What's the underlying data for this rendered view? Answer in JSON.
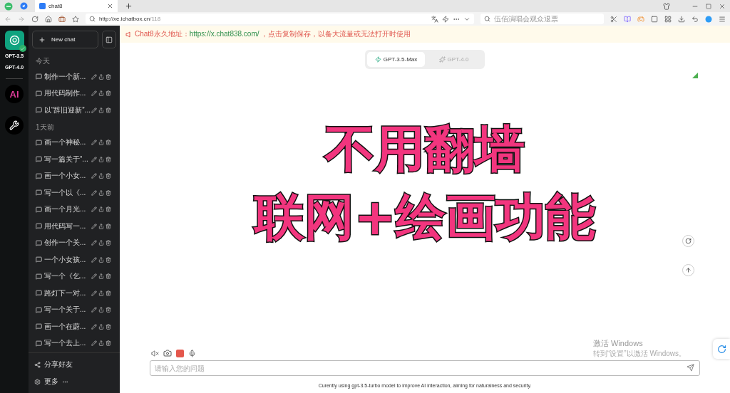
{
  "browser": {
    "tabs": [
      {
        "title": "chat8",
        "selected": true
      }
    ],
    "url": {
      "host": "http://xe.ichatbox.cn",
      "path": "/118"
    },
    "search_placeholder": "伍佰演唱会观众退票"
  },
  "rail": {
    "models": [
      "GPT-3.5",
      "GPT-4.0"
    ],
    "ai_logo": "AI"
  },
  "sidebar": {
    "new_chat": "New chat",
    "groups": [
      {
        "label": "今天",
        "items": [
          "制作一个新...",
          "用代码制作...",
          "以“辞旧迎新”..."
        ]
      },
      {
        "label": "1天前",
        "items": [
          "画一个神秘...",
          "写一篇关于“...",
          "画一个小女...",
          "写一个以《...",
          "画一个月光...",
          "用代码写一...",
          "创作一个关...",
          "一个小女孩...",
          "写一个《乞...",
          "路灯下一对...",
          "写一个关于...",
          "画一个在蔚...",
          "写一个去上..."
        ]
      }
    ],
    "footer": [
      {
        "kind": "share",
        "label": "分享好友"
      },
      {
        "kind": "more",
        "label": "更多"
      }
    ]
  },
  "banner": {
    "prefix": "Chat8永久地址：",
    "link": "https://x.chat838.com/",
    "suffix": " ，点击复制保存，以备大流量或无法打开时使用"
  },
  "model_tabs": [
    {
      "kind": "fast",
      "label": "GPT-3.5-Max",
      "selected": true
    },
    {
      "kind": "spark",
      "label": "GPT-4.0",
      "selected": false
    }
  ],
  "overlay": [
    "不用翻墙",
    "联网+绘画功能"
  ],
  "input": {
    "placeholder": "请输入您的问题"
  },
  "note": "Curently using gpt-3.5-turbo model to improve AI interaction, aiming for naturalness and security.",
  "os_watermark": [
    "激活 Windows",
    "转到“设置”以激活 Windows。"
  ]
}
